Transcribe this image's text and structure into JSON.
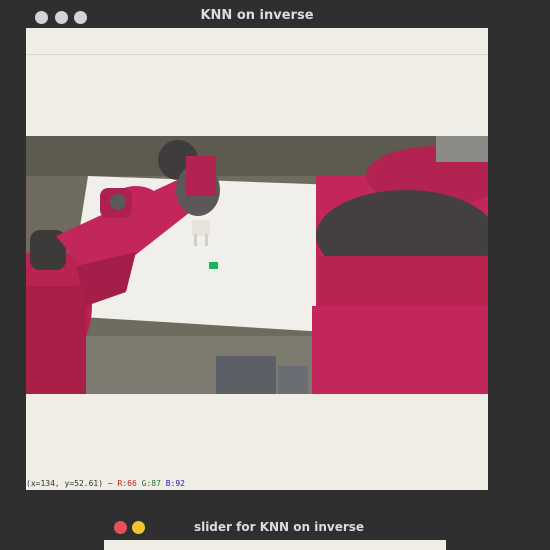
{
  "main_window": {
    "title": "KNN on inverse",
    "status": {
      "coords": "(x=134, y=52.61) ~",
      "r": "R:66",
      "g": "G:87",
      "b": "B:92"
    }
  },
  "slider_window": {
    "title": "slider for KNN on inverse"
  },
  "colors": {
    "robot_red": "#c2265a",
    "close_button": "#e8505b",
    "minimize_button": "#f2c230"
  }
}
